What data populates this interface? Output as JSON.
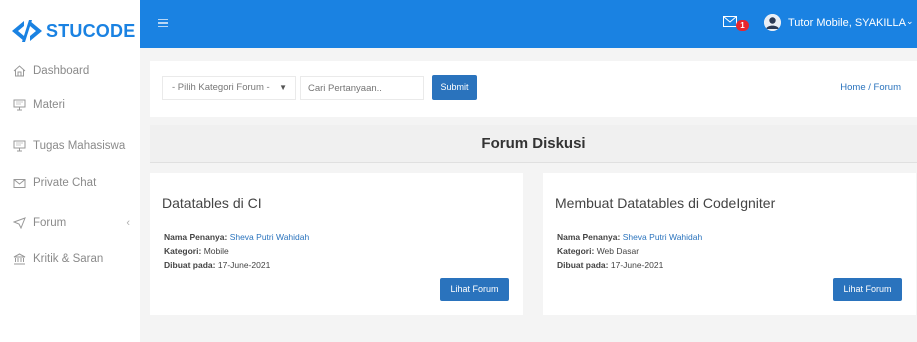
{
  "brand": {
    "name": "STUCODE",
    "accent": "#1a82e2"
  },
  "sidebar": {
    "items": [
      {
        "label": "Dashboard",
        "icon": "home-icon"
      },
      {
        "label": "Materi",
        "icon": "monitor-icon"
      },
      {
        "label": "Tugas Mahasiswa",
        "icon": "monitor-icon"
      },
      {
        "label": "Private Chat",
        "icon": "mail-icon"
      },
      {
        "label": "Forum",
        "icon": "send-icon",
        "chevron": "‹"
      },
      {
        "label": "Kritik & Saran",
        "icon": "bank-icon"
      }
    ]
  },
  "topbar": {
    "menu_icon": "hamburger-icon",
    "mail_icon": "mail-icon",
    "notification_count": "1",
    "user_name": "Tutor Mobile, SYAKILLA",
    "user_caret": "⌄"
  },
  "filter": {
    "category_select": "- Pilih Kategori Forum -",
    "search_placeholder": "Cari Pertanyaan..",
    "submit_label": "Submit",
    "breadcrumb": "Home / Forum"
  },
  "main": {
    "heading": "Forum Diskusi",
    "cards": [
      {
        "title": "Datatables di CI",
        "asker_label": "Nama Penanya:",
        "asker": "Sheva Putri Wahidah",
        "category_label": "Kategori:",
        "category": "Mobile",
        "date_label": "Dibuat pada:",
        "date": "17-June-2021",
        "button": "Lihat Forum"
      },
      {
        "title": "Membuat Datatables di CodeIgniter",
        "asker_label": "Nama Penanya:",
        "asker": "Sheva Putri Wahidah",
        "category_label": "Kategori:",
        "category": "Web Dasar",
        "date_label": "Dibuat pada:",
        "date": "17-June-2021",
        "button": "Lihat Forum"
      }
    ]
  }
}
